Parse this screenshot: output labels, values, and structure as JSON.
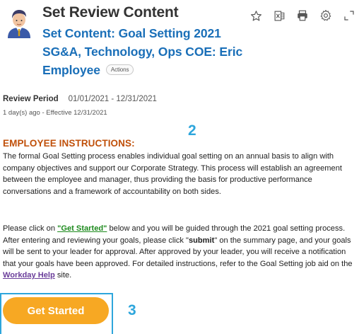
{
  "header": {
    "title": "Set Review Content",
    "subtitle_line1": "Set Content: Goal Setting 2021",
    "subtitle_line2": "SG&A, Technology, Ops COE: Eric",
    "subtitle_line3": "Employee",
    "actions_label": "Actions"
  },
  "toolbar": {
    "icons": [
      "star-icon",
      "excel-export-icon",
      "print-icon",
      "gear-icon",
      "expand-icon"
    ]
  },
  "review": {
    "label": "Review Period",
    "value": "01/01/2021 - 12/31/2021",
    "meta": "1 day(s) ago - Effective 12/31/2021"
  },
  "annotations": {
    "step2": "2",
    "step3": "3"
  },
  "instructions": {
    "heading": "EMPLOYEE INSTRUCTIONS:",
    "para1": "The formal Goal Setting process enables individual goal setting on an annual basis to align with company objectives and support our Corporate Strategy. This process will establish an agreement between the employee and manager, thus providing the basis for productive performance conversations and a framework of accountability on both sides.",
    "para2_a": "Please click on ",
    "para2_link": "\"Get Started\"",
    "para2_b": " below and you will be guided through the 2021 goal setting process.  After entering and reviewing your goals, please click \"",
    "para2_bold": "submit",
    "para2_c": "\" on the summary page, and your goals will be sent to your leader for approval. After approved by your leader, you will receive a notification that your goals have been approved. For detailed instructions, refer to the Goal Setting job aid on the ",
    "para2_link2": "Workday Help",
    "para2_d": " site."
  },
  "button": {
    "label": "Get Started"
  },
  "colors": {
    "title_blue": "#1a6fb8",
    "heading_orange": "#c0500a",
    "button_orange": "#f7a823",
    "annotation_blue": "#2ea6dc"
  }
}
